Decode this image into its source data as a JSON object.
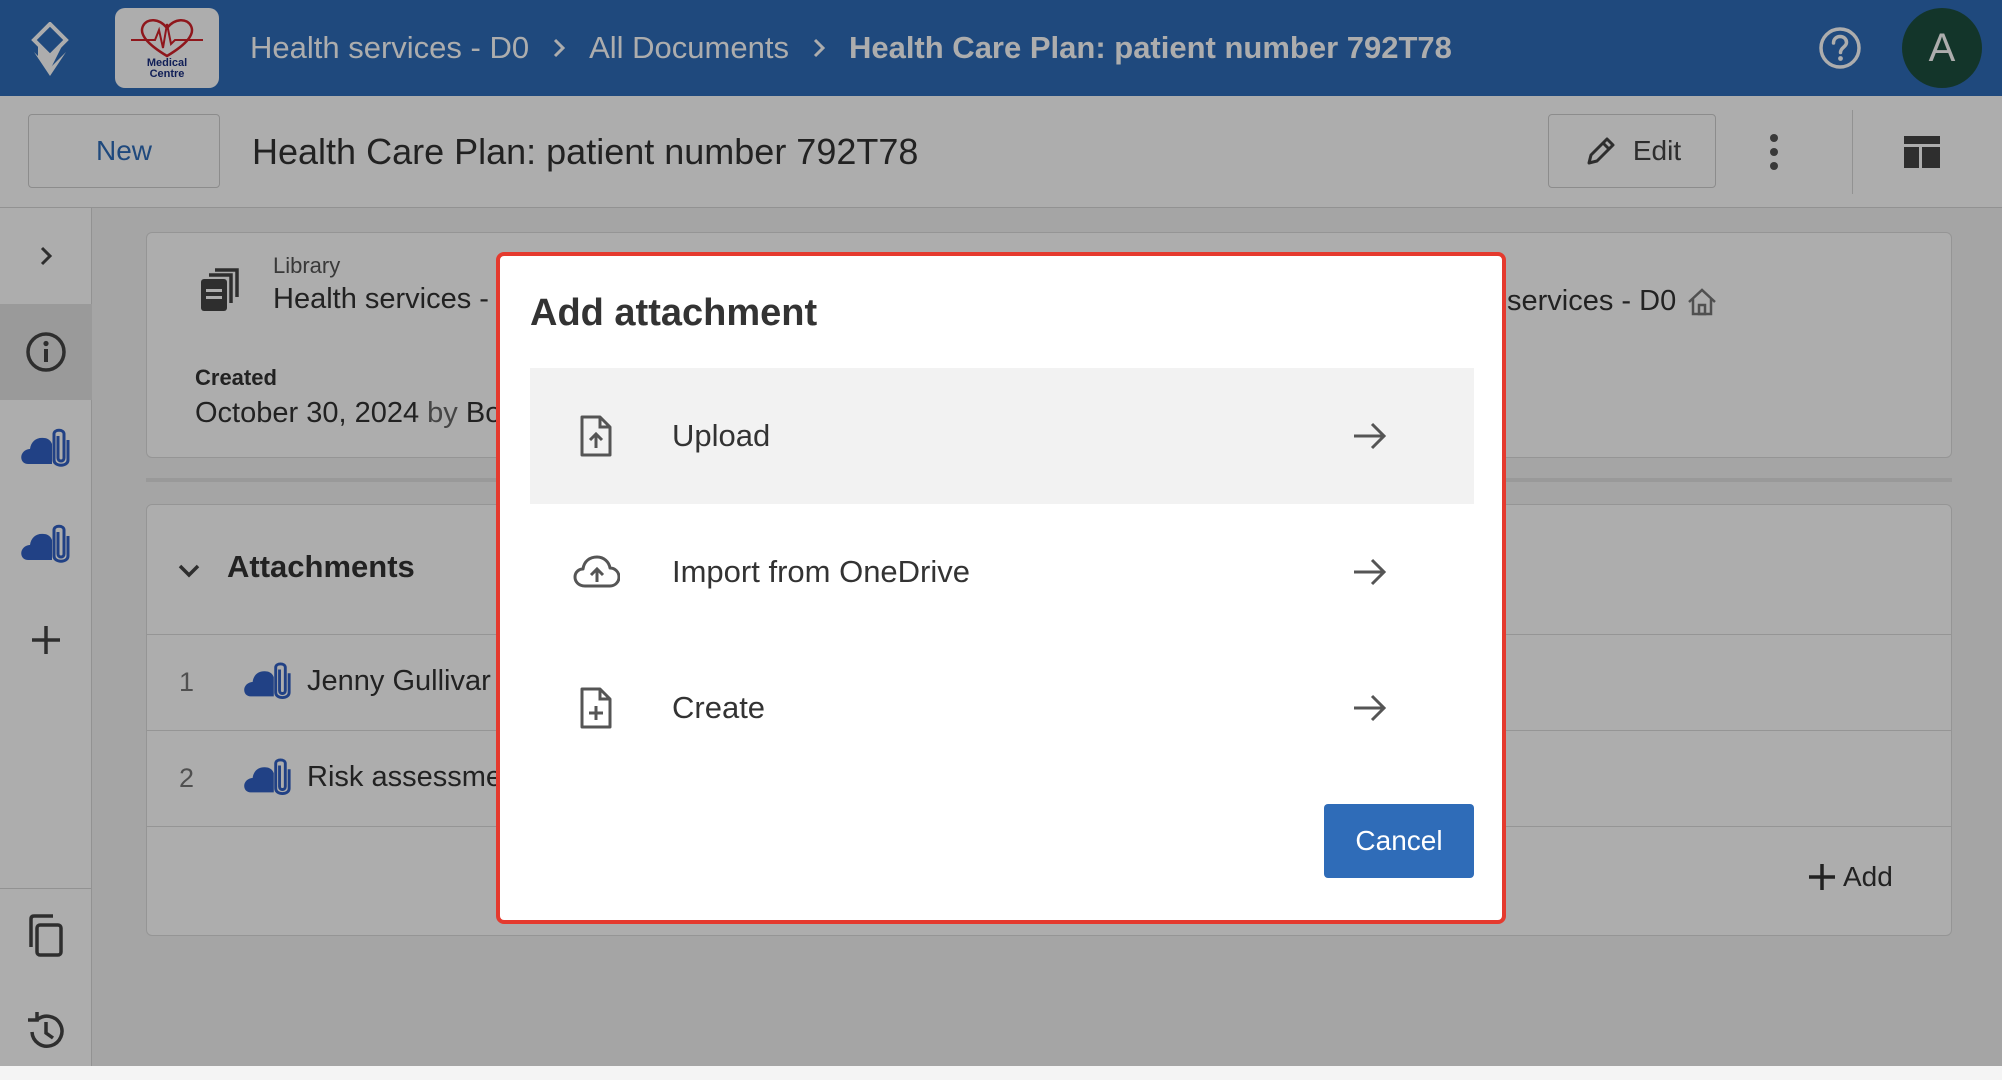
{
  "header": {
    "brand_line1": "Medical",
    "brand_line2": "Centre",
    "breadcrumbs": [
      {
        "label": "Health services - D0"
      },
      {
        "label": "All Documents"
      },
      {
        "label": "Health Care Plan: patient number 792T78"
      }
    ],
    "avatar_initial": "A"
  },
  "toolbar": {
    "new_label": "New",
    "doc_title": "Health Care Plan: patient number 792T78",
    "edit_label": "Edit"
  },
  "info_card": {
    "library_label": "Library",
    "library_value": "Health services -",
    "library_value_right": "services - D0",
    "created_label": "Created",
    "created_date": "October 30, 2024",
    "created_by": "by",
    "created_by_name": "Bo"
  },
  "attachments": {
    "title": "Attachments",
    "rows": [
      {
        "num": "1",
        "name": "Jenny Gullivar"
      },
      {
        "num": "2",
        "name": "Risk assessme"
      }
    ],
    "add_label": "Add"
  },
  "dialog": {
    "title": "Add attachment",
    "options": [
      {
        "label": "Upload",
        "icon": "upload-file-icon"
      },
      {
        "label": "Import from OneDrive",
        "icon": "cloud-upload-icon"
      },
      {
        "label": "Create",
        "icon": "new-file-icon"
      }
    ],
    "cancel_label": "Cancel"
  },
  "colors": {
    "brand_blue": "#2f6cb8",
    "highlight_border": "#e53a2e",
    "avatar_bg": "#1d4f3f"
  }
}
